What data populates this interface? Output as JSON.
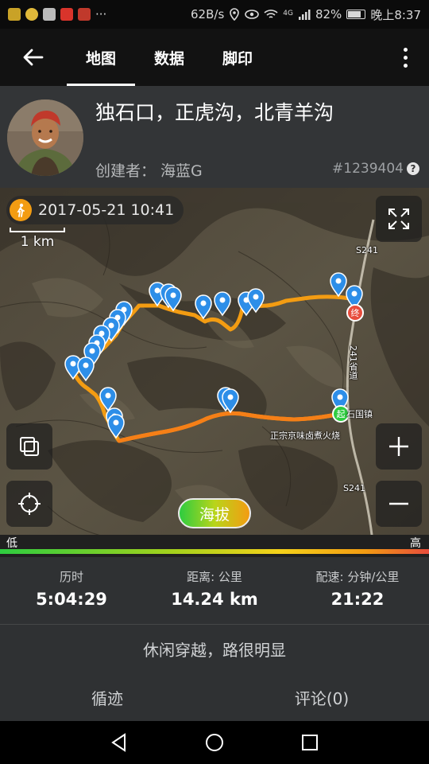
{
  "status_bar": {
    "network_speed": "62B/s",
    "signal_label": "4G",
    "battery": "82%",
    "battery_level": 0.82,
    "time": "晚上8:37"
  },
  "app_bar": {
    "tabs": [
      {
        "label": "地图",
        "active": true
      },
      {
        "label": "数据",
        "active": false
      },
      {
        "label": "脚印",
        "active": false
      }
    ]
  },
  "track": {
    "title": "独石口，正虎沟，北青羊沟",
    "creator": "创建者：  海蓝G",
    "id": "#1239404"
  },
  "map": {
    "datetime": "2017-05-21 10:41",
    "scale_label": "1 km",
    "altitude_button": "海拔",
    "place_labels": {
      "road_s241_top": "S241",
      "road_s241_bottom": "S241",
      "road_241": "241省道",
      "town": "石国镇",
      "restaurant": "正宗京味卤煮火烧"
    },
    "markers": {
      "end": "终",
      "start": "起"
    }
  },
  "legend": {
    "low": "低",
    "high": "高"
  },
  "stats": [
    {
      "label": "历时",
      "value": "5:04:29"
    },
    {
      "label": "距离: 公里",
      "value": "14.24 km"
    },
    {
      "label": "配速: 分钟/公里",
      "value": "21:22"
    }
  ],
  "description": "休闲穿越，路很明显",
  "bottom_tabs": [
    {
      "label": "循迹"
    },
    {
      "label": "评论(0)"
    }
  ],
  "colors": {
    "track_orange": "#f39c12",
    "pin_blue": "#2d8ee8",
    "start_green": "#2ecc40",
    "end_red": "#e74c3c"
  }
}
